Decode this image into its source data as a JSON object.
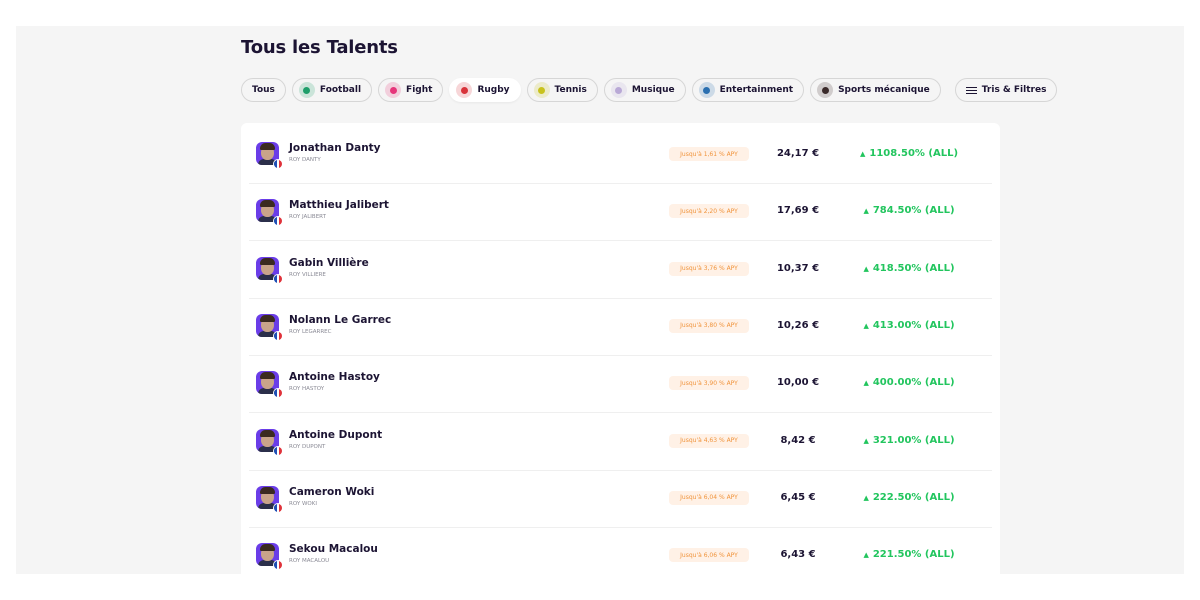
{
  "page_title": "Tous les Talents",
  "filters": [
    {
      "label": "Tous",
      "icon": null,
      "color": null,
      "active": false
    },
    {
      "label": "Football",
      "icon": "football-icon",
      "color": "#1e9e6a",
      "active": false
    },
    {
      "label": "Fight",
      "icon": "fight-icon",
      "color": "#e6357a",
      "active": false
    },
    {
      "label": "Rugby",
      "icon": "rugby-icon",
      "color": "#d8323a",
      "active": true
    },
    {
      "label": "Tennis",
      "icon": "tennis-icon",
      "color": "#c8c21d",
      "active": false
    },
    {
      "label": "Musique",
      "icon": "music-icon",
      "color": "#b9a9d6",
      "active": false
    },
    {
      "label": "Entertainment",
      "icon": "entertainment-icon",
      "color": "#2a6fb0",
      "active": false
    },
    {
      "label": "Sports mécanique",
      "icon": "motorsport-icon",
      "color": "#3a2a2a",
      "active": false
    }
  ],
  "filter_button_label": "Tris & Filtres",
  "accent_colors": {
    "positive": "#22c55e",
    "apy_text": "#f0943c",
    "apy_bg": "#fff1e6",
    "avatar_bg": "#6a3de8"
  },
  "talents": [
    {
      "name": "Jonathan Danty",
      "handle": "ROY DANTY",
      "apy": "Jusqu'à 1,61 % APY",
      "price": "24,17 €",
      "change": "1108.50% (ALL)",
      "flag": "france"
    },
    {
      "name": "Matthieu Jalibert",
      "handle": "ROY JALIBERT",
      "apy": "Jusqu'à 2,20 % APY",
      "price": "17,69 €",
      "change": "784.50% (ALL)",
      "flag": "france"
    },
    {
      "name": "Gabin Villière",
      "handle": "ROY VILLIERE",
      "apy": "Jusqu'à 3,76 % APY",
      "price": "10,37 €",
      "change": "418.50% (ALL)",
      "flag": "france"
    },
    {
      "name": "Nolann Le Garrec",
      "handle": "ROY LEGARREC",
      "apy": "Jusqu'à 3,80 % APY",
      "price": "10,26 €",
      "change": "413.00% (ALL)",
      "flag": "france"
    },
    {
      "name": "Antoine Hastoy",
      "handle": "ROY HASTOY",
      "apy": "Jusqu'à 3,90 % APY",
      "price": "10,00 €",
      "change": "400.00% (ALL)",
      "flag": "france"
    },
    {
      "name": "Antoine Dupont",
      "handle": "ROY DUPONT",
      "apy": "Jusqu'à 4,63 % APY",
      "price": "8,42 €",
      "change": "321.00% (ALL)",
      "flag": "france"
    },
    {
      "name": "Cameron Woki",
      "handle": "ROY WOKI",
      "apy": "Jusqu'à 6,04 % APY",
      "price": "6,45 €",
      "change": "222.50% (ALL)",
      "flag": "france"
    },
    {
      "name": "Sekou Macalou",
      "handle": "ROY MACALOU",
      "apy": "Jusqu'à 6,06 % APY",
      "price": "6,43 €",
      "change": "221.50% (ALL)",
      "flag": "france"
    }
  ]
}
